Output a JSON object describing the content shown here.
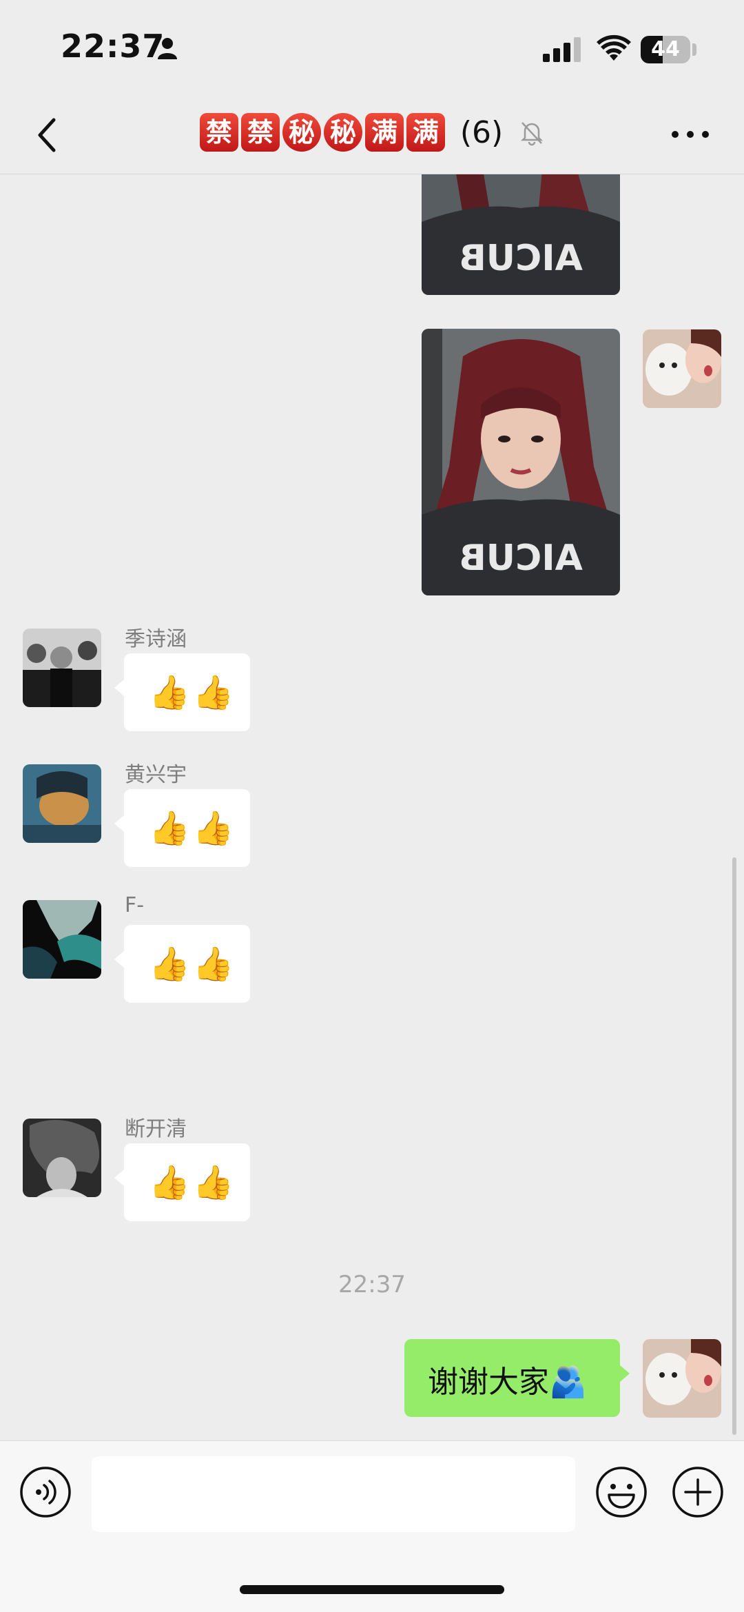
{
  "status_bar": {
    "time": "22:37",
    "battery": "44",
    "battery_level": 0.44
  },
  "header": {
    "title_badges": [
      "禁",
      "禁",
      "秘",
      "秘",
      "满",
      "满"
    ],
    "member_count": "(6)",
    "back_icon": "chevron-left-icon",
    "mute_icon": "bell-slash-icon",
    "more_icon": "more-dots-icon"
  },
  "messages": [
    {
      "type": "image",
      "from": "me",
      "desc": "selfie-photo-top-partial"
    },
    {
      "type": "image",
      "from": "me",
      "desc": "selfie-photo"
    },
    {
      "type": "text",
      "from": "other",
      "sender": "季诗涵",
      "text": "👍👍"
    },
    {
      "type": "text",
      "from": "other",
      "sender": "黄兴宇",
      "text": "👍👍"
    },
    {
      "type": "text",
      "from": "other",
      "sender": "F-",
      "text": "👍👍"
    },
    {
      "type": "text",
      "from": "other",
      "sender": "断开清",
      "text": "👍👍"
    },
    {
      "type": "timestamp",
      "text": "22:37"
    },
    {
      "type": "text",
      "from": "me",
      "text": "谢谢大家🫂"
    }
  ],
  "input_bar": {
    "voice_icon": "voice-icon",
    "emoji_icon": "smile-icon",
    "more_icon": "plus-circle-icon",
    "text_value": ""
  },
  "colors": {
    "background": "#ededed",
    "bubble_self": "#95ec69",
    "bubble_other": "#ffffff",
    "badge_red": "#d92a1e"
  }
}
